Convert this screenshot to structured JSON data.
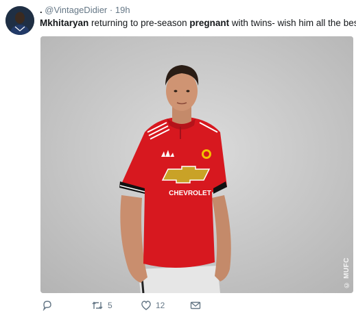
{
  "tweet": {
    "display_name": ".",
    "handle": "@VintageDidier",
    "separator": "·",
    "time": "19h",
    "text_part1": "Mkhitaryan",
    "text_part2": " returning to pre-season ",
    "text_part3": "pregnant",
    "text_part4": " with twins- wish him all the best.",
    "photo": {
      "watermark": "© MUFC",
      "shirt_sponsor": "CHEVROLET"
    }
  },
  "actions": {
    "reply_count": "",
    "retweet_count": "5",
    "like_count": "12"
  },
  "colors": {
    "jersey_red": "#d7181f",
    "background_gray": "#c4c4c4",
    "meta_text": "#657786"
  }
}
